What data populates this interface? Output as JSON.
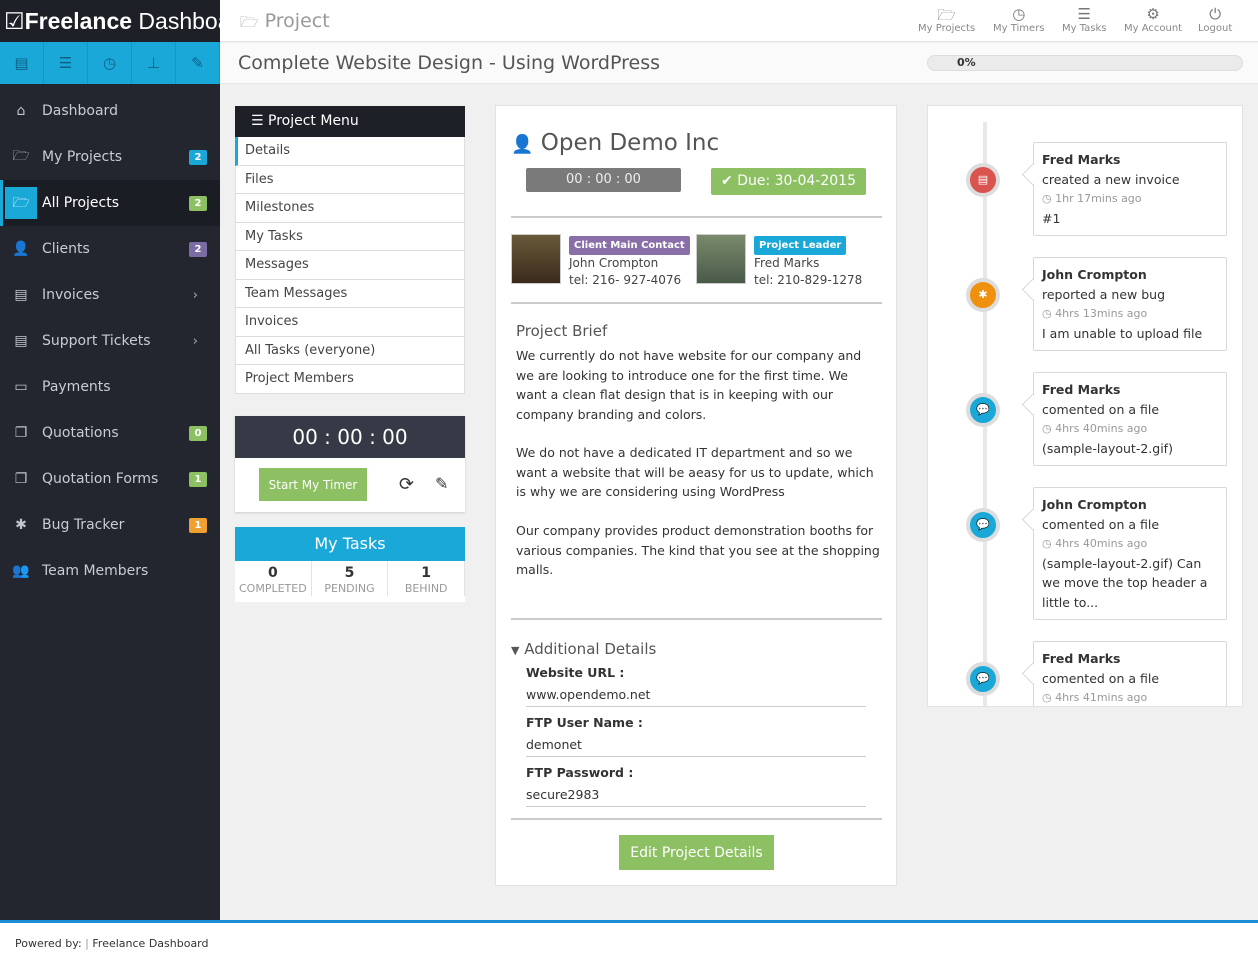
{
  "app": {
    "title_bold": "Freelance",
    "title_rest": "Dashboard",
    "page_title": "Project"
  },
  "top_nav": [
    {
      "label": "My Projects",
      "icon": "folder-open-icon"
    },
    {
      "label": "My Timers",
      "icon": "clock-icon"
    },
    {
      "label": "My Tasks",
      "icon": "list-icon"
    },
    {
      "label": "My Account",
      "icon": "cogs-icon"
    },
    {
      "label": "Logout",
      "icon": "power-icon"
    }
  ],
  "sidebar": {
    "items": [
      {
        "label": "Dashboard",
        "icon": "home-icon"
      },
      {
        "label": "My Projects",
        "icon": "folder-open-icon",
        "badge": "2",
        "badge_color": "#1aa8d8"
      },
      {
        "label": "All Projects",
        "icon": "folder-open-icon",
        "badge": "2",
        "badge_color": "#8cc063",
        "active": true
      },
      {
        "label": "Clients",
        "icon": "user-icon",
        "badge": "2",
        "badge_color": "#7c6ca4"
      },
      {
        "label": "Invoices",
        "icon": "invoice-icon",
        "chevron": true
      },
      {
        "label": "Support Tickets",
        "icon": "file-icon",
        "chevron": true
      },
      {
        "label": "Payments",
        "icon": "credit-card-icon"
      },
      {
        "label": "Quotations",
        "icon": "copy-icon",
        "badge": "0",
        "badge_color": "#8cc063"
      },
      {
        "label": "Quotation Forms",
        "icon": "copy-icon",
        "badge": "1",
        "badge_color": "#8cc063"
      },
      {
        "label": "Bug Tracker",
        "icon": "bug-icon",
        "badge": "1",
        "badge_color": "#f0a030"
      },
      {
        "label": "Team Members",
        "icon": "users-icon"
      }
    ]
  },
  "project": {
    "name": "Complete Website Design - Using WordPress",
    "progress_label": "0%",
    "progress": 0
  },
  "project_menu": {
    "title": "Project Menu",
    "items": [
      "Details",
      "Files",
      "Milestones",
      "My Tasks",
      "Messages",
      "Team Messages",
      "Invoices",
      "All Tasks (everyone)",
      "Project Members"
    ]
  },
  "timer": {
    "value": "00 : 00 : 00",
    "start_label": "Start My Timer"
  },
  "my_tasks": {
    "title": "My Tasks",
    "stats": [
      {
        "value": "0",
        "label": "COMPLETED"
      },
      {
        "value": "5",
        "label": "PENDING"
      },
      {
        "value": "1",
        "label": "BEHIND"
      }
    ]
  },
  "client": {
    "name": "Open Demo Inc",
    "timer": "00 : 00 : 00",
    "due": "Due: 30-04-2015"
  },
  "contacts": [
    {
      "label": "Client Main Contact",
      "name": "John Crompton",
      "tel": "tel: 216- 927-4076",
      "color": "#8a6ea8"
    },
    {
      "label": "Project Leader",
      "name": "Fred Marks",
      "tel": "tel: 210-829-1278",
      "color": "#1aa8d8"
    }
  ],
  "brief": {
    "title": "Project Brief",
    "paragraphs": [
      "We currently do not have  website for our company and we are looking to introduce one for the first time. We want a clean flat design that is in keeping with our company branding and colors.",
      "We do not have a dedicated IT department and so we want a website that will be aeasy for us to update, which is why we are considering using WordPress",
      "Our company provides product demonstration booths for various companies. The kind that you see at the shopping malls."
    ]
  },
  "additional": {
    "title": "Additional Details",
    "fields": [
      {
        "label": "Website URL :",
        "value": "www.opendemo.net"
      },
      {
        "label": "FTP User Name :",
        "value": "demonet"
      },
      {
        "label": "FTP Password :",
        "value": "secure2983"
      }
    ],
    "edit_label": "Edit Project Details"
  },
  "timeline": [
    {
      "name": "Fred Marks",
      "action": "created a new invoice",
      "time": "1hr 17mins ago",
      "detail": "#1",
      "color": "#d9534f",
      "icon": "invoice-icon"
    },
    {
      "name": "John Crompton",
      "action": "reported a new bug",
      "time": "4hrs 13mins ago",
      "detail": "I am unable to upload file",
      "color": "#f0900f",
      "icon": "bug-icon"
    },
    {
      "name": "Fred Marks",
      "action": "comented on a file",
      "time": "4hrs 40mins ago",
      "detail": "(sample-layout-2.gif)",
      "color": "#1aa8d8",
      "icon": "comment-icon"
    },
    {
      "name": "John Crompton",
      "action": "comented on a file",
      "time": "4hrs 40mins ago",
      "detail": "(sample-layout-2.gif) Can we move the top header a little to...",
      "color": "#1aa8d8",
      "icon": "comment-icon"
    },
    {
      "name": "Fred Marks",
      "action": "comented on a file",
      "time": "4hrs 41mins ago",
      "detail": "",
      "color": "#1aa8d8",
      "icon": "comment-icon"
    }
  ],
  "footer": {
    "powered": "Powered by:",
    "sep": "|",
    "brand": "Freelance Dashboard"
  }
}
